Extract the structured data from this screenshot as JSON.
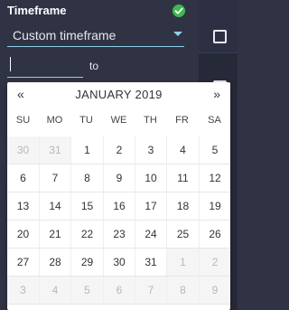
{
  "filter": {
    "title": "Timeframe",
    "selected": "Custom timeframe",
    "from_value": "",
    "to_label": "to",
    "colors": {
      "accent": "#8fd0ec",
      "check": "#3fb950",
      "panel": "#2f3344"
    }
  },
  "calendar": {
    "prev": "«",
    "next": "»",
    "month_label": "JANUARY 2019",
    "weekdays": [
      "SU",
      "MO",
      "TU",
      "WE",
      "TH",
      "FR",
      "SA"
    ],
    "weeks": [
      [
        {
          "d": "30",
          "out": true
        },
        {
          "d": "31",
          "out": true
        },
        {
          "d": "1"
        },
        {
          "d": "2"
        },
        {
          "d": "3"
        },
        {
          "d": "4"
        },
        {
          "d": "5"
        }
      ],
      [
        {
          "d": "6"
        },
        {
          "d": "7"
        },
        {
          "d": "8"
        },
        {
          "d": "9"
        },
        {
          "d": "10"
        },
        {
          "d": "11"
        },
        {
          "d": "12"
        }
      ],
      [
        {
          "d": "13"
        },
        {
          "d": "14"
        },
        {
          "d": "15"
        },
        {
          "d": "16"
        },
        {
          "d": "17"
        },
        {
          "d": "18"
        },
        {
          "d": "19"
        }
      ],
      [
        {
          "d": "20"
        },
        {
          "d": "21"
        },
        {
          "d": "22"
        },
        {
          "d": "23"
        },
        {
          "d": "24"
        },
        {
          "d": "25"
        },
        {
          "d": "26"
        }
      ],
      [
        {
          "d": "27"
        },
        {
          "d": "28"
        },
        {
          "d": "29"
        },
        {
          "d": "30"
        },
        {
          "d": "31"
        },
        {
          "d": "1",
          "out": true
        },
        {
          "d": "2",
          "out": true
        }
      ],
      [
        {
          "d": "3",
          "out": true
        },
        {
          "d": "4",
          "out": true
        },
        {
          "d": "5",
          "out": true
        },
        {
          "d": "6",
          "out": true
        },
        {
          "d": "7",
          "out": true
        },
        {
          "d": "8",
          "out": true
        },
        {
          "d": "9",
          "out": true
        }
      ]
    ]
  }
}
